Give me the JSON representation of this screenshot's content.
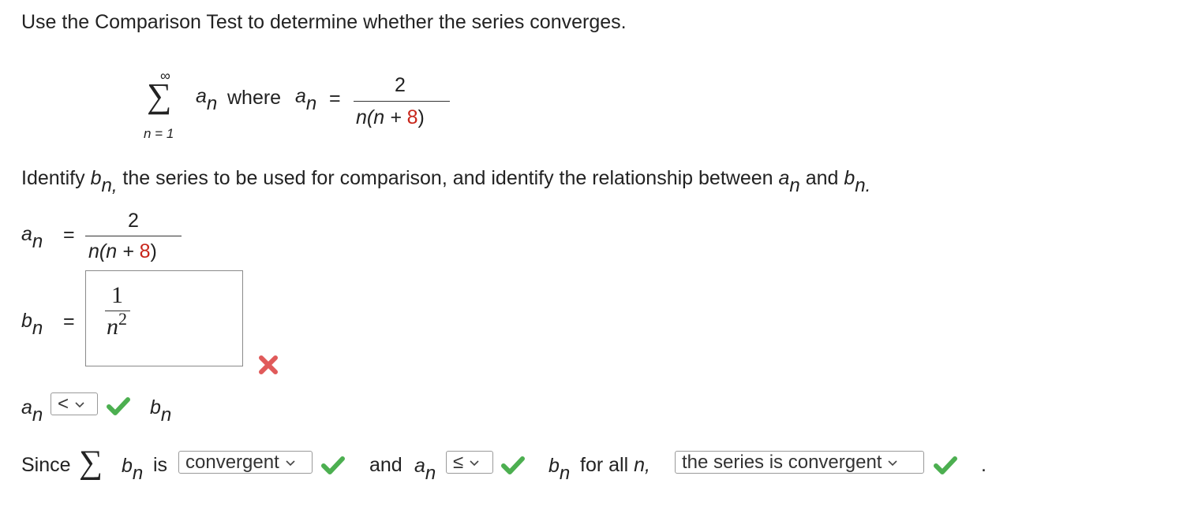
{
  "question": {
    "prompt": "Use the Comparison Test to determine whether the series converges.",
    "series": {
      "sum_upper": "∞",
      "sum_lower": "n = 1",
      "term": "a",
      "term_sub": "n",
      "where_label": "where",
      "def_term": "a",
      "def_sub": "n",
      "equals": "=",
      "numerator": "2",
      "denominator_prefix": "n(n + ",
      "denominator_const": "8",
      "denominator_suffix": ")"
    },
    "instruction_start": "Identify ",
    "instruction_b": "b",
    "instruction_b_sub": "n,",
    "instruction_mid": " the series to be used for comparison, and identify the relationship between ",
    "instruction_a": "a",
    "instruction_a_sub": "n",
    "instruction_and": " and ",
    "instruction_b2": "b",
    "instruction_b2_sub": "n."
  },
  "an_row": {
    "label": "a",
    "label_sub": "n",
    "equals": "=",
    "numerator": "2",
    "denominator_prefix": "n(n + ",
    "denominator_const": "8",
    "denominator_suffix": ")"
  },
  "bn_row": {
    "label": "b",
    "label_sub": "n",
    "equals": "=",
    "answer_numerator": "1",
    "answer_denominator": "n",
    "answer_exponent": "2",
    "status": "incorrect"
  },
  "relation_row": {
    "left": "a",
    "left_sub": "n",
    "selected": "<",
    "right": "b",
    "right_sub": "n",
    "status": "correct"
  },
  "conclusion_row": {
    "since": "Since",
    "sum_symbol": "∑",
    "b": "b",
    "b_sub": "n",
    "is": "is",
    "convergence_selected": "convergent",
    "and": "and",
    "a": "a",
    "a_sub": "n",
    "relation_selected": "≤",
    "b2": "b",
    "b2_sub": "n",
    "for_all": "for all",
    "for_all_n": "n,",
    "result_selected": "the series is convergent",
    "period": "."
  },
  "colors": {
    "correct": "#4caf50",
    "incorrect": "#e05a5a",
    "constant_highlight": "#c8261b"
  }
}
